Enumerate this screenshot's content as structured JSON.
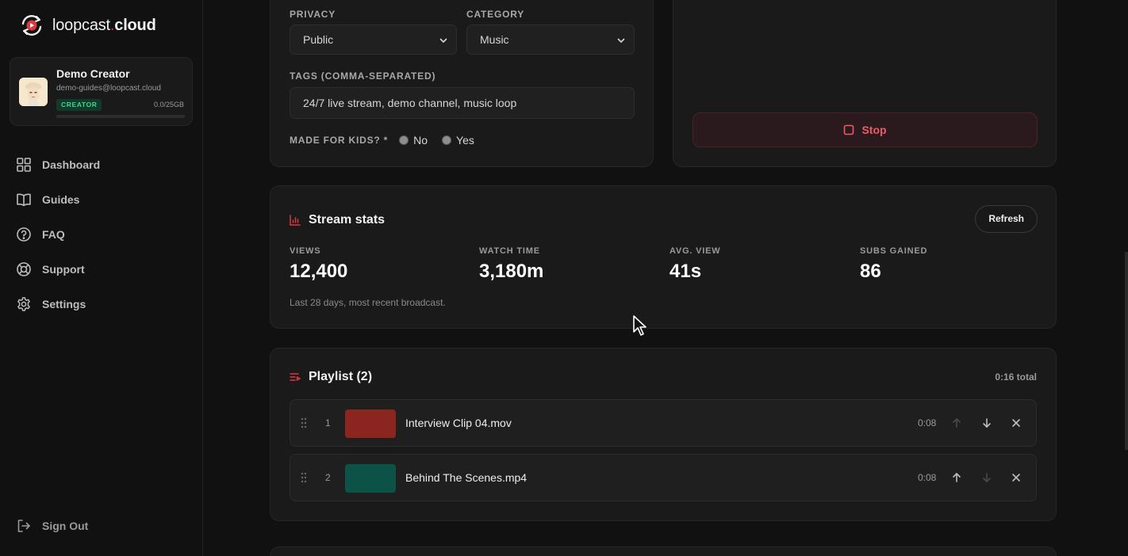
{
  "brand": {
    "name_left": "loopcast",
    "name_dot": ".",
    "name_right": "cloud"
  },
  "profile": {
    "name": "Demo Creator",
    "email": "demo-guides@loopcast.cloud",
    "badge": "CREATOR",
    "storage": "0.0/25GB",
    "storage_fraction": 0.0
  },
  "nav": {
    "items": [
      {
        "label": "Dashboard",
        "icon": "grid-icon"
      },
      {
        "label": "Guides",
        "icon": "book-icon"
      },
      {
        "label": "FAQ",
        "icon": "help-circle-icon"
      },
      {
        "label": "Support",
        "icon": "lifebuoy-icon"
      },
      {
        "label": "Settings",
        "icon": "gear-icon"
      }
    ],
    "signout": "Sign Out"
  },
  "settings": {
    "privacy_label": "PRIVACY",
    "privacy_value": "Public",
    "category_label": "CATEGORY",
    "category_value": "Music",
    "tags_label": "TAGS (COMMA-SEPARATED)",
    "tags_value": "24/7 live stream, demo channel, music loop",
    "kids_label": "MADE FOR KIDS? *",
    "kids_no": "No",
    "kids_yes": "Yes"
  },
  "control": {
    "stop_label": "Stop"
  },
  "stats": {
    "title": "Stream stats",
    "refresh": "Refresh",
    "items": [
      {
        "label": "VIEWS",
        "value": "12,400"
      },
      {
        "label": "WATCH TIME",
        "value": "3,180m"
      },
      {
        "label": "AVG. VIEW",
        "value": "41s"
      },
      {
        "label": "SUBS GAINED",
        "value": "86"
      }
    ],
    "note": "Last 28 days, most recent broadcast."
  },
  "playlist": {
    "title": "Playlist (2)",
    "total": "0:16 total",
    "items": [
      {
        "index": "1",
        "name": "Interview Clip 04.mov",
        "duration": "0:08",
        "color": "#8b2520"
      },
      {
        "index": "2",
        "name": "Behind The Scenes.mp4",
        "duration": "0:08",
        "color": "#0c5246"
      }
    ]
  },
  "colors": {
    "accent": "#e0373f",
    "success": "#3dd68c",
    "danger_text": "#ef5a69"
  }
}
